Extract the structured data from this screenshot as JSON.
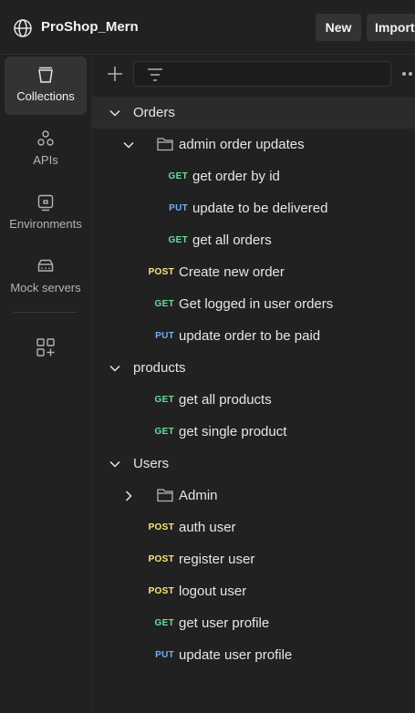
{
  "header": {
    "workspace_name": "ProShop_Mern",
    "new_label": "New",
    "import_label": "Import"
  },
  "rail": {
    "items": [
      {
        "label": "Collections",
        "icon": "collections-icon",
        "active": true
      },
      {
        "label": "APIs",
        "icon": "apis-icon"
      },
      {
        "label": "Environments",
        "icon": "environments-icon"
      },
      {
        "label": "Mock servers",
        "icon": "mock-servers-icon"
      }
    ],
    "add_icon": "add-panel-icon"
  },
  "tree": {
    "collections": [
      {
        "name": "Orders",
        "children": [
          {
            "folder": "admin order updates",
            "requests": [
              {
                "method": "GET",
                "name": "get order by id"
              },
              {
                "method": "PUT",
                "name": "update to be delivered"
              },
              {
                "method": "GET",
                "name": "get all orders"
              }
            ]
          },
          {
            "method": "POST",
            "name": "Create new order"
          },
          {
            "method": "GET",
            "name": "Get logged in user orders"
          },
          {
            "method": "PUT",
            "name": "update order to be paid"
          }
        ]
      },
      {
        "name": "products",
        "children": [
          {
            "method": "GET",
            "name": "get all products"
          },
          {
            "method": "GET",
            "name": "get single product"
          }
        ]
      },
      {
        "name": "Users",
        "children": [
          {
            "folder": "Admin",
            "collapsed": true
          },
          {
            "method": "POST",
            "name": "auth user"
          },
          {
            "method": "POST",
            "name": "register user"
          },
          {
            "method": "POST",
            "name": "logout user"
          },
          {
            "method": "GET",
            "name": "get user profile"
          },
          {
            "method": "PUT",
            "name": "update user profile"
          }
        ]
      }
    ]
  },
  "colors": {
    "background": "#212121",
    "get": "#6bdd9a",
    "post": "#ffe47e",
    "put": "#74aef6"
  }
}
